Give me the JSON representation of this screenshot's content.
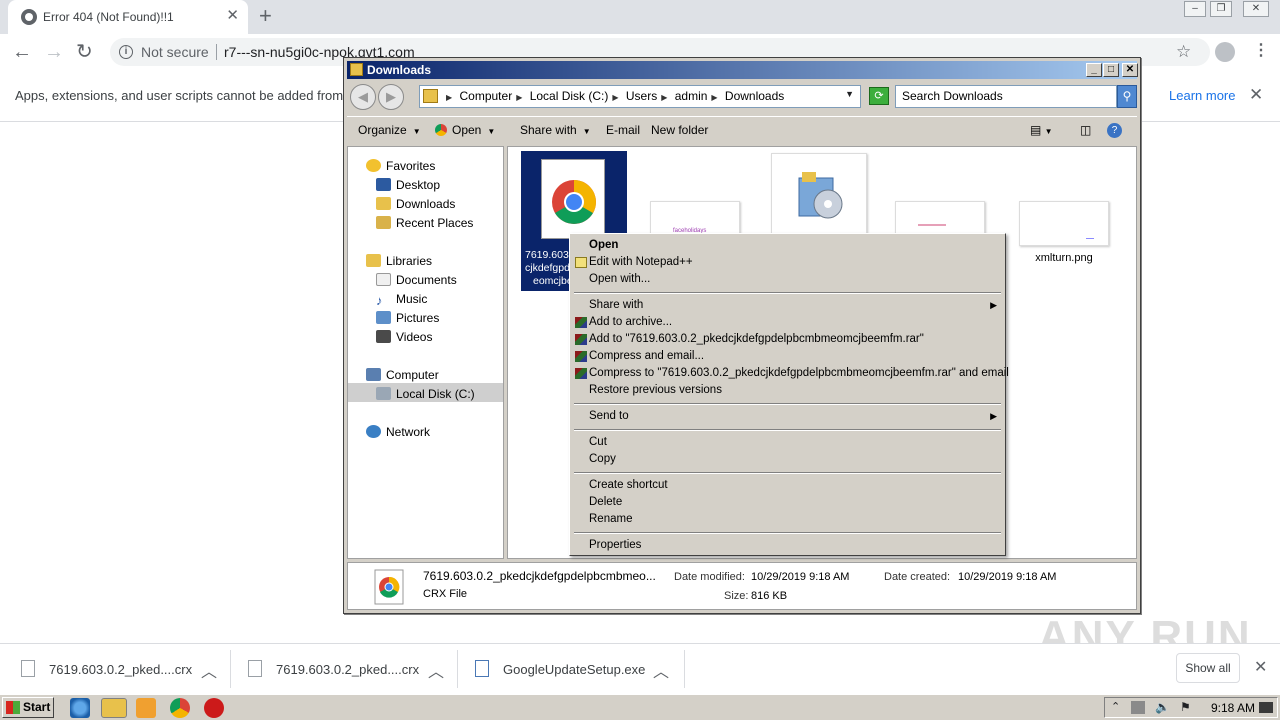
{
  "browser": {
    "tab_title": "Error 404 (Not Found)!!1",
    "security_label": "Not secure",
    "url": "r7---sn-nu5gi0c-npok.gvt1.com",
    "infobar_message": "Apps, extensions, and user scripts cannot be added from th",
    "infobar_link": "Learn more"
  },
  "explorer": {
    "title": "Downloads",
    "breadcrumbs": [
      "Computer",
      "Local Disk (C:)",
      "Users",
      "admin",
      "Downloads"
    ],
    "search_placeholder": "Search Downloads",
    "commands": {
      "organize": "Organize",
      "open": "Open",
      "share_with": "Share with",
      "email": "E-mail",
      "new_folder": "New folder"
    },
    "nav": {
      "favorites": "Favorites",
      "desktop": "Desktop",
      "downloads": "Downloads",
      "recent_places": "Recent Places",
      "libraries": "Libraries",
      "documents": "Documents",
      "music": "Music",
      "pictures": "Pictures",
      "videos": "Videos",
      "computer": "Computer",
      "local_disk": "Local Disk (C:)",
      "network": "Network"
    },
    "files": {
      "selected_label_line1": "7619.603",
      "selected_label_line2": "cjkdefgpd",
      "selected_label_line3": "eomcjbe",
      "thumb2_text": "faceholidays",
      "file5_label": "xmlturn.png"
    },
    "details": {
      "name": "7619.603.0.2_pkedcjkdefgpdelpbcmbmeo...",
      "type": "CRX File",
      "modified_label": "Date modified:",
      "modified_value": "10/29/2019 9:18 AM",
      "created_label": "Date created:",
      "created_value": "10/29/2019 9:18 AM",
      "size_label": "Size:",
      "size_value": "816 KB"
    }
  },
  "context_menu": {
    "open": "Open",
    "edit_notepad": "Edit with Notepad++",
    "open_with": "Open with...",
    "share_with": "Share with",
    "add_archive": "Add to archive...",
    "add_to_rar": "Add to \"7619.603.0.2_pkedcjkdefgpdelpbcmbmeomcjbeemfm.rar\"",
    "compress_email": "Compress and email...",
    "compress_rar_email": "Compress to \"7619.603.0.2_pkedcjkdefgpdelpbcmbmeomcjbeemfm.rar\" and email",
    "restore": "Restore previous versions",
    "send_to": "Send to",
    "cut": "Cut",
    "copy": "Copy",
    "create_shortcut": "Create shortcut",
    "delete": "Delete",
    "rename": "Rename",
    "properties": "Properties"
  },
  "downloads_shelf": {
    "items": [
      {
        "name": "7619.603.0.2_pked....crx"
      },
      {
        "name": "7619.603.0.2_pked....crx"
      },
      {
        "name": "GoogleUpdateSetup.exe"
      }
    ],
    "show_all": "Show all"
  },
  "watermark": "ANY RUN",
  "taskbar": {
    "start": "Start",
    "clock": "9:18 AM"
  },
  "colors": {
    "title_bar": "#0a246a",
    "selection": "#0a246a",
    "link": "#1a73e8"
  }
}
